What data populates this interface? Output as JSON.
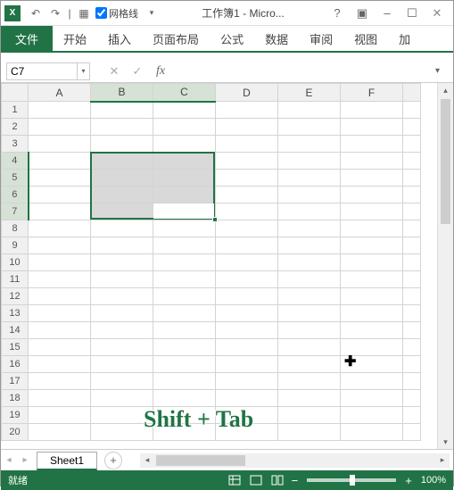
{
  "titlebar": {
    "gridlines_label": "网格线",
    "title": "工作簿1 - Micro...",
    "gridlines_checked": true
  },
  "ribbon": {
    "file": "文件",
    "tabs": [
      "开始",
      "插入",
      "页面布局",
      "公式",
      "数据",
      "审阅",
      "视图",
      "加"
    ]
  },
  "formula": {
    "namebox": "C7",
    "fx": "fx"
  },
  "columns": [
    "A",
    "B",
    "C",
    "D",
    "E",
    "F"
  ],
  "rows": [
    "1",
    "2",
    "3",
    "4",
    "5",
    "6",
    "7",
    "8",
    "9",
    "10",
    "11",
    "12",
    "13",
    "14",
    "15",
    "16",
    "17",
    "18",
    "19",
    "20"
  ],
  "selected_cols": [
    "B",
    "C"
  ],
  "selected_rows": [
    "4",
    "5",
    "6",
    "7"
  ],
  "active_cell": "C7",
  "overlay": "Shift + Tab",
  "sheets": {
    "active": "Sheet1",
    "add": "+"
  },
  "statusbar": {
    "ready": "就绪",
    "zoom": "100%"
  },
  "icons": {
    "undo": "↶",
    "redo": "↷",
    "help": "?",
    "ribbon_toggle": "▣",
    "minimize": "–",
    "maximize": "☐",
    "close": "✕",
    "cancel": "✕",
    "enter": "✓",
    "chevron_down": "▾",
    "chevron_left": "◂",
    "chevron_right": "▸",
    "chevron_up": "▴",
    "minus": "−",
    "plus": "+"
  }
}
